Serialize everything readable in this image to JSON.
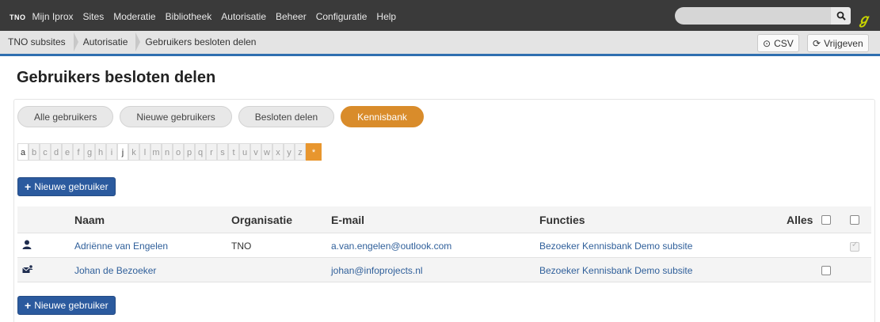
{
  "topnav": {
    "brand": "TNO",
    "menu": [
      "Mijn Iprox",
      "Sites",
      "Moderatie",
      "Bibliotheek",
      "Autorisatie",
      "Beheer",
      "Configuratie",
      "Help"
    ],
    "search_placeholder": ""
  },
  "breadcrumb": [
    "TNO subsites",
    "Autorisatie",
    "Gebruikers besloten delen"
  ],
  "actions": {
    "csv": "CSV",
    "release": "Vrijgeven"
  },
  "page_title": "Gebruikers besloten delen",
  "tabs": [
    "Alle gebruikers",
    "Nieuwe gebruikers",
    "Besloten delen",
    "Kennisbank"
  ],
  "active_tab": "Kennisbank",
  "alphabet": [
    "a",
    "b",
    "c",
    "d",
    "e",
    "f",
    "g",
    "h",
    "i",
    "j",
    "k",
    "l",
    "m",
    "n",
    "o",
    "p",
    "q",
    "r",
    "s",
    "t",
    "u",
    "v",
    "w",
    "x",
    "y",
    "z",
    "*"
  ],
  "new_user_label": "Nieuwe gebruiker",
  "table": {
    "headers": {
      "name": "Naam",
      "org": "Organisatie",
      "email": "E-mail",
      "functions": "Functies",
      "all": "Alles"
    },
    "rows": [
      {
        "name": "Adriënne van Engelen",
        "org": "TNO",
        "email": "a.van.engelen@outlook.com",
        "functions": "Bezoeker Kennisbank Demo subsite"
      },
      {
        "name": "Johan de Bezoeker",
        "org": "",
        "email": "johan@infoprojects.nl",
        "functions": "Bezoeker Kennisbank Demo subsite"
      }
    ]
  },
  "colors": {
    "accent_orange": "#d98c2b",
    "primary_blue": "#2b5a9e",
    "nav_bg": "#3a3a3a"
  }
}
